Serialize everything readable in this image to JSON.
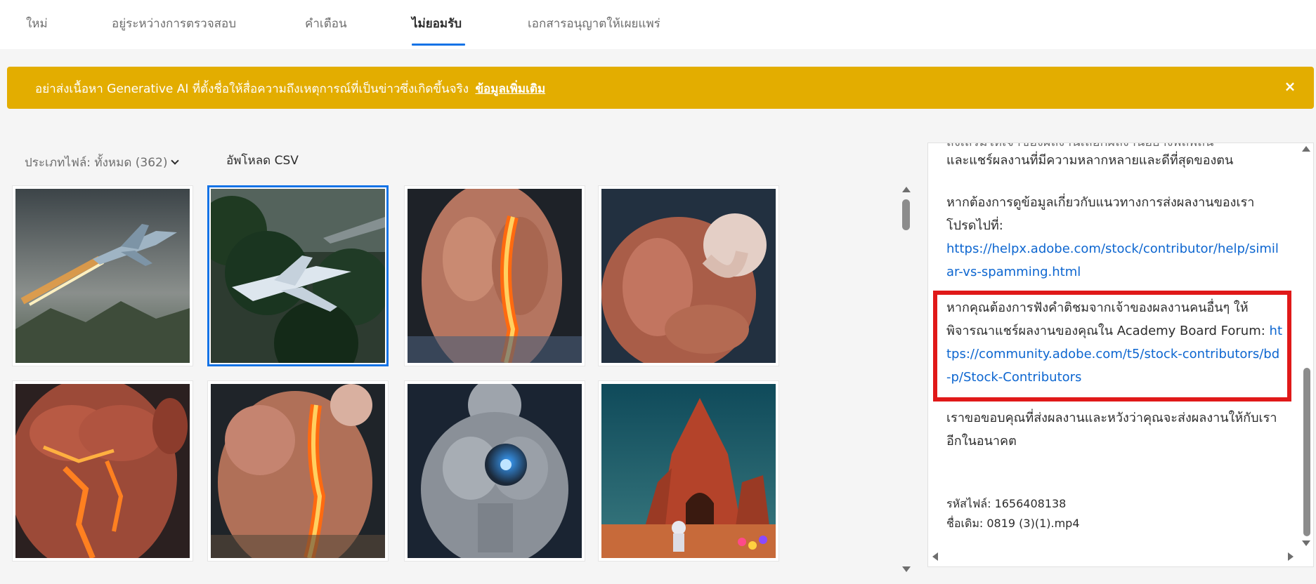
{
  "tabs": [
    {
      "label": "ใหม่"
    },
    {
      "label": "อยู่ระหว่างการตรวจสอบ"
    },
    {
      "label": "คำเตือน"
    },
    {
      "label": "ไม่ยอมรับ",
      "active": true
    },
    {
      "label": "เอกสารอนุญาตให้เผยแพร่"
    }
  ],
  "banner": {
    "text": "อย่าส่งเนื้อหา Generative AI ที่ตั้งชื่อให้สื่อความถึงเหตุการณ์ที่เป็นข่าวซึ่งเกิดขึ้นจริง",
    "link": "ข้อมูลเพิ่มเติม",
    "close_icon": "×",
    "color": "#e3ad00"
  },
  "filters": {
    "file_type": "ประเภทไฟล์: ทั้งหมด (362)",
    "upload_csv": "อัพโหลด CSV"
  },
  "grid": {
    "thumbnails": [
      {
        "subject": "fighter-jet-firing",
        "selected": false
      },
      {
        "subject": "fighter-jet-jungle",
        "selected": true
      },
      {
        "subject": "muscle-anatomy-spine-glow",
        "selected": false
      },
      {
        "subject": "muscle-anatomy-thinking",
        "selected": false
      },
      {
        "subject": "muscle-anatomy-torso-glow",
        "selected": false
      },
      {
        "subject": "muscle-anatomy-spine-glow-2",
        "selected": false
      },
      {
        "subject": "silver-body-blue-glow",
        "selected": false
      },
      {
        "subject": "astronaut-red-temple",
        "selected": false
      }
    ]
  },
  "panel": {
    "top_line_partial": "ส่งเสริมให้เจ้าของผลงานเลือกผลงานอย่างพิถีพิถัน",
    "top_line": "และแชร์ผลงานที่มีความหลากหลายและดีที่สุดของตน",
    "guidelines_text": "หากต้องการดูข้อมูลเกี่ยวกับแนวทางการส่งผลงานของเรา โปรดไปที่:",
    "guidelines_link": "https://helpx.adobe.com/stock/contributor/help/similar-vs-spamming.html",
    "forum_text": "หากคุณต้องการฟังคำติชมจากเจ้าของผลงานคนอื่นๆ ให้พิจารณาแชร์ผลงานของคุณใน Academy Board Forum:",
    "forum_link": "https://community.adobe.com/t5/stock-contributors/bd-p/Stock-Contributors",
    "thanks_text": "เราขอขอบคุณที่ส่งผลงานและหวังว่าคุณจะส่งผลงานให้กับเราอีกในอนาคต",
    "file_id": "รหัสไฟล์: 1656408138",
    "original_name": "ชื่อเดิม: 0819 (3)(1).mp4",
    "highlight_color": "#e01919"
  }
}
